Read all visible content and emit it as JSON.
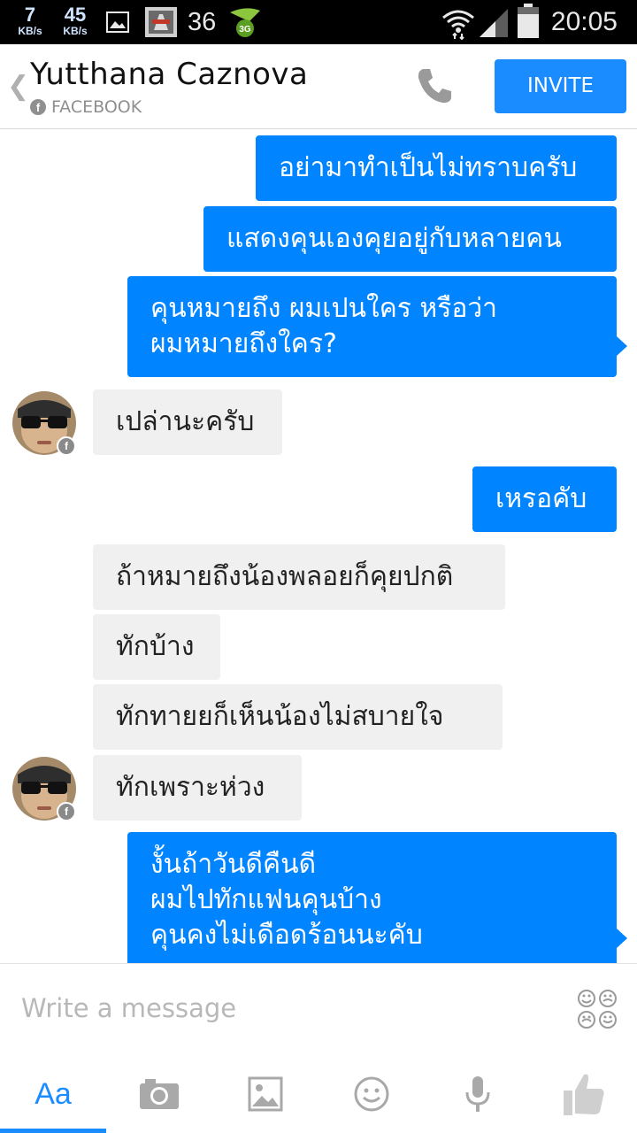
{
  "status_bar": {
    "down_speed": "7",
    "down_unit": "KB/s",
    "up_speed": "45",
    "up_unit": "KB/s",
    "notification_count": "36",
    "time": "20:05",
    "icons": [
      "image-icon",
      "app-notification-icon",
      "3g-icon",
      "wifi-icon",
      "signal-icon",
      "battery-icon"
    ]
  },
  "header": {
    "contact_name": "Yutthana Caznova",
    "source": "FACEBOOK",
    "invite_label": "INVITE"
  },
  "messages": [
    {
      "dir": "out",
      "text": "อย่ามาทำเป็นไม่ทราบครับ"
    },
    {
      "dir": "out",
      "text": "แสดงคุนเองคุยอยู่กับหลายคน"
    },
    {
      "dir": "out",
      "text": "คุนหมายถึง ผมเปนใคร หรือว่า\nผมหมายถึงใคร?"
    },
    {
      "dir": "in",
      "text": "เปล่านะครับ"
    },
    {
      "dir": "out",
      "text": "เหรอคับ"
    },
    {
      "dir": "in",
      "text": "ถ้าหมายถึงน้องพลอยก็คุยปกติ"
    },
    {
      "dir": "in",
      "text": "ทักบ้าง"
    },
    {
      "dir": "in",
      "text": "ทักทายยก็เห็นน้องไม่สบายใจ"
    },
    {
      "dir": "in",
      "text": "ทักเพราะห่วง"
    },
    {
      "dir": "out",
      "text": "งั้นถ้าวันดีคืนดี\nผมไปทักแฟนคุนบ้าง\nคุนคงไม่เดือดร้อนนะคับ"
    }
  ],
  "composer": {
    "placeholder": "Write a message"
  },
  "toolbar": {
    "text_tab_label": "Aa",
    "icons": [
      "camera-icon",
      "gallery-icon",
      "emoji-icon",
      "microphone-icon",
      "like-icon"
    ]
  },
  "colors": {
    "accent": "#1a8cff",
    "outgoing_bubble": "#0084ff",
    "incoming_bubble": "#f0f0f0"
  }
}
